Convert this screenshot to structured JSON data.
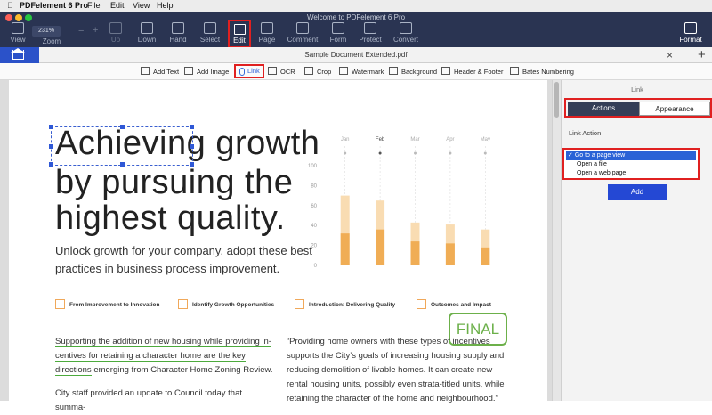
{
  "menubar": {
    "app": "PDFelement 6 Pro",
    "items": [
      "File",
      "Edit",
      "View",
      "Help"
    ]
  },
  "window": {
    "title": "Welcome to PDFelement 6 Pro"
  },
  "toolbar": {
    "zoom_value": "231%",
    "buttons": [
      "View",
      "Zoom",
      "Up",
      "Down",
      "Hand",
      "Select",
      "Edit",
      "Page",
      "Comment",
      "Form",
      "Protect",
      "Convert",
      "Format"
    ]
  },
  "tab": {
    "document_title": "Sample Document Extended.pdf"
  },
  "edit_toolbar": {
    "items": [
      "Add Text",
      "Add Image",
      "Link",
      "OCR",
      "Crop",
      "Watermark",
      "Background",
      "Header & Footer",
      "Bates Numbering"
    ]
  },
  "document": {
    "headline": [
      "Achieving growth",
      "by pursuing the",
      "highest quality."
    ],
    "subtext": "Unlock growth for your company, adopt these best practices in business process improvement.",
    "features": [
      "From Improvement to Innovation",
      "Identify Growth Opportunities",
      "Introduction: Delivering Quality",
      "Outcomes and Impact"
    ],
    "stamp": "FINAL",
    "left_para_underlined": "Supporting the addition of new housing while providing in-centives for retaining a character home are the key directions",
    "left_para_rest": "emerging from Character Home Zoning Review.",
    "left_para_cut": "City staff provided an update to Council today that summa-",
    "right_para": "“Providing home owners with these types of incentives supports the City’s goals of increasing housing supply and reducing demolition of livable homes.  It can create new rental housing units, possibly even strata-titled units, while retaining the character of the home and neighbourhood.”"
  },
  "chart_data": {
    "type": "bar",
    "categories": [
      "Jan",
      "Feb",
      "Mar",
      "Apr",
      "May"
    ],
    "series": [
      {
        "values": [
          32,
          36,
          24,
          22,
          18
        ]
      },
      {
        "values": [
          70,
          65,
          43,
          41,
          36
        ]
      }
    ],
    "y_ticks": [
      "100",
      "80",
      "60",
      "40",
      "20",
      "0"
    ],
    "ylim": [
      0,
      100
    ],
    "colors": [
      "#f0ad55",
      "#f9dcb2"
    ]
  },
  "panel": {
    "title": "Link",
    "tabs": [
      "Actions",
      "Appearance"
    ],
    "section_label": "Link Action",
    "options": [
      "Go to a page view",
      "Open a file",
      "Open a web page"
    ],
    "selected_index": 0,
    "add_label": "Add"
  },
  "colors": {
    "toolbar_bg": "#2a3452",
    "accent": "#2448d4",
    "highlight": "#e02020",
    "stamp": "#6cb04a"
  }
}
